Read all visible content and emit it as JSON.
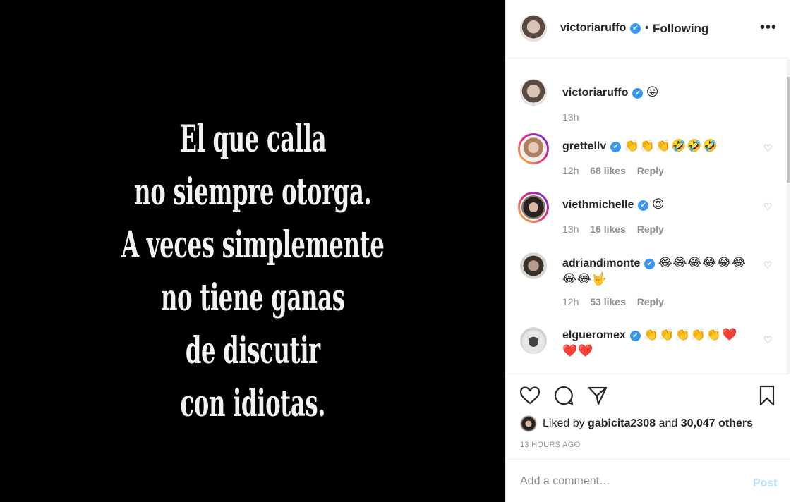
{
  "media": {
    "quote_lines": [
      "El que calla",
      "no siempre otorga.",
      "A veces simplemente",
      "no tiene ganas",
      "de discutir",
      "con idiotas."
    ]
  },
  "header": {
    "username": "victoriaruffo",
    "verified_glyph": "✔",
    "separator": "•",
    "follow_status": "Following",
    "more_label": "•••"
  },
  "caption": {
    "username": "victoriaruffo",
    "text": "😛",
    "time": "13h"
  },
  "comments": [
    {
      "username": "grettellv",
      "text": "👏👏👏🤣🤣🤣",
      "time": "12h",
      "likes": "68 likes",
      "reply": "Reply"
    },
    {
      "username": "viethmichelle",
      "text": "😍",
      "time": "13h",
      "likes": "16 likes",
      "reply": "Reply"
    },
    {
      "username": "adriandimonte",
      "text": "😂😂😂😂😂😂😂😂🤟",
      "time": "12h",
      "likes": "53 likes",
      "reply": "Reply"
    },
    {
      "username": "elgueromex",
      "text": "👏👏👏👏👏❤️❤️❤️",
      "time": "",
      "likes": "",
      "reply": ""
    }
  ],
  "heart_glyph": "♡",
  "likes": {
    "prefix": "Liked by",
    "user": "gabicita2308",
    "middle": "and",
    "others": "30,047 others"
  },
  "timestamp": "13 HOURS AGO",
  "add_comment": {
    "placeholder": "Add a comment…",
    "post_label": "Post"
  },
  "colors": {
    "verified": "#3897f0",
    "post_disabled": "#b2dffc",
    "secondary_text": "#8e8e8e"
  },
  "icons": [
    "heart-icon",
    "comment-icon",
    "share-icon",
    "bookmark-icon",
    "verified-icon",
    "more-icon"
  ]
}
